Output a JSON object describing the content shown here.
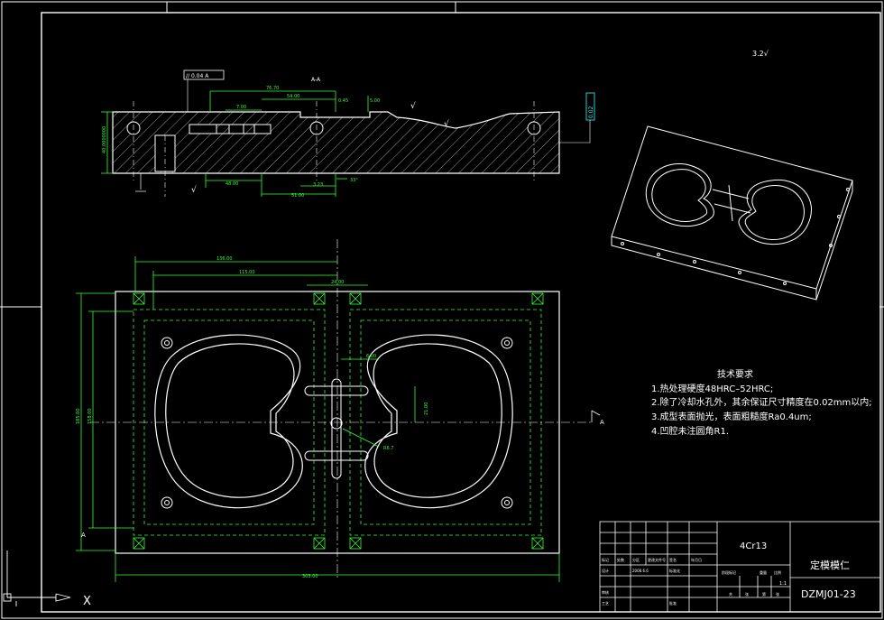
{
  "colors": {
    "background": "#000000",
    "outline": "#ffffff",
    "dimension": "#33ff33",
    "hatch": "#ffffff",
    "annotation": "#33ffff"
  },
  "section_view": {
    "label": "A-A",
    "roughness_symbol": "√",
    "dims": {
      "d1": "76.70",
      "d2": "54.00",
      "d3": "7.00",
      "d4": "48.00",
      "d5": "51.00",
      "d6": "3.23",
      "d7": "33°",
      "d8": "0.45",
      "d9": "5.00",
      "d10": "40.0000000"
    },
    "tolerance_box": "// 0.04 A",
    "right_box": "0.02"
  },
  "plan_view": {
    "dims": {
      "top1": "136.00",
      "top2": "115.00",
      "top3": "24.00",
      "left1": "185.00",
      "left2": "158.00",
      "right1": "21.00",
      "mid1": "6.00",
      "ang": "R6.7",
      "bottom": "303.00"
    },
    "section_marks": [
      "A",
      "A"
    ]
  },
  "top_right_mark": "3.2√",
  "tech_requirements": {
    "title": "技术要求",
    "items": [
      "1.热处理硬度48HRC–52HRC;",
      "2.除了冷却水孔外，其余保证尺寸精度在0.02mm以内;",
      "3.成型表面抛光，表面粗糙度Ra0.4um;",
      "4.凹腔未注圆角R1."
    ]
  },
  "title_block": {
    "material": "4Cr13",
    "part_name": "定模模仁",
    "drawing_no": "DZMJ01-23",
    "scale": "1:1",
    "small_labels": [
      "标记",
      "处数",
      "分区",
      "更改文件号",
      "签名",
      "年月日",
      "设计",
      "2008.6.6",
      "标准化",
      "阶段标记",
      "重量",
      "比例",
      "审核",
      "工艺",
      "批准",
      "共",
      "张",
      "第",
      "张"
    ]
  },
  "ucs": {
    "x_label": "X"
  }
}
